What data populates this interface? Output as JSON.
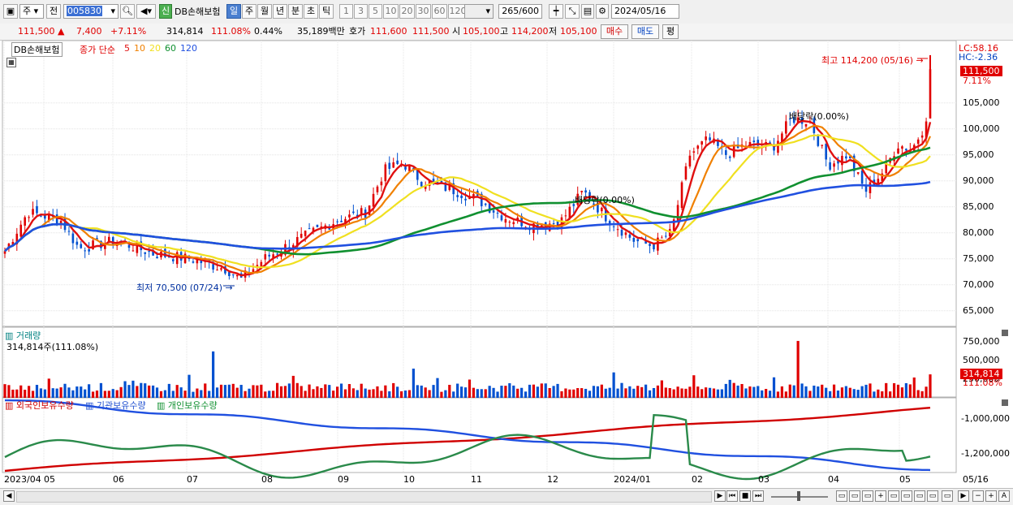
{
  "toolbar": {
    "period_dropdown": "주",
    "prev_label": "전",
    "stock_code": "005830",
    "credit_badge": "신",
    "stock_name": "DB손해보험",
    "periods": [
      "일",
      "주",
      "월",
      "년",
      "분",
      "초",
      "틱"
    ],
    "minute_intervals": [
      "1",
      "3",
      "5",
      "10",
      "20",
      "30",
      "60",
      "120"
    ],
    "count_value": "265",
    "count_total": "/600",
    "date": "2024/05/16"
  },
  "quote": {
    "price": "111,500",
    "change": "7,400",
    "change_pct": "+7.11%",
    "volume": "314,814",
    "volume_ratio": "111.08%",
    "turnover": "0.44%",
    "amount": "35,189백만",
    "ask_label": "호가",
    "ask": "111,600",
    "bid": "111,500",
    "open_label": "시",
    "open": "105,100",
    "high_label": "고",
    "high": "114,200",
    "low_label": "저",
    "low": "105,100",
    "buy_label": "매수",
    "sell_label": "매도",
    "eval_label": "평"
  },
  "price_pane": {
    "name": "DB손해보험",
    "close_label": "종가 단순",
    "ma_labels": [
      "5",
      "10",
      "20",
      "60",
      "120"
    ],
    "max_label": "최고 114,200 (05/16)",
    "min_label": "최저 70,500 (07/24)",
    "lc_label": "LC:58.16",
    "hc_label": "HC:-2.36",
    "current_box": "111,500",
    "current_pct": "7.11%",
    "annot1": "배당락(0.00%)",
    "annot2": "배당락(0.00%)",
    "yticks": [
      "105,000",
      "100,000",
      "95,000",
      "90,000",
      "85,000",
      "80,000",
      "75,000",
      "70,000",
      "65,000"
    ]
  },
  "volume_pane": {
    "title": "거래량",
    "value_text": "314,814주(111.08%)",
    "yticks": [
      "750,000",
      "500,000",
      "250,000"
    ],
    "current_box": "314,814",
    "current_pct": "111.08%"
  },
  "holders_pane": {
    "legend": [
      "외국인보유수량",
      "기관보유수량",
      "개인보유수량"
    ],
    "yticks": [
      "-1,000,000",
      "-1,200,000"
    ]
  },
  "x_axis": [
    "2023/04",
    "05",
    "06",
    "07",
    "08",
    "09",
    "10",
    "11",
    "12",
    "2024/01",
    "02",
    "03",
    "04",
    "05"
  ],
  "x_axis_right": "05/16",
  "colors": {
    "up": "#e00000",
    "down": "#0050d0",
    "ma5": "#e01010",
    "ma10": "#f08000",
    "ma20": "#f0e020",
    "ma60": "#109030",
    "ma120": "#2050e0"
  }
}
